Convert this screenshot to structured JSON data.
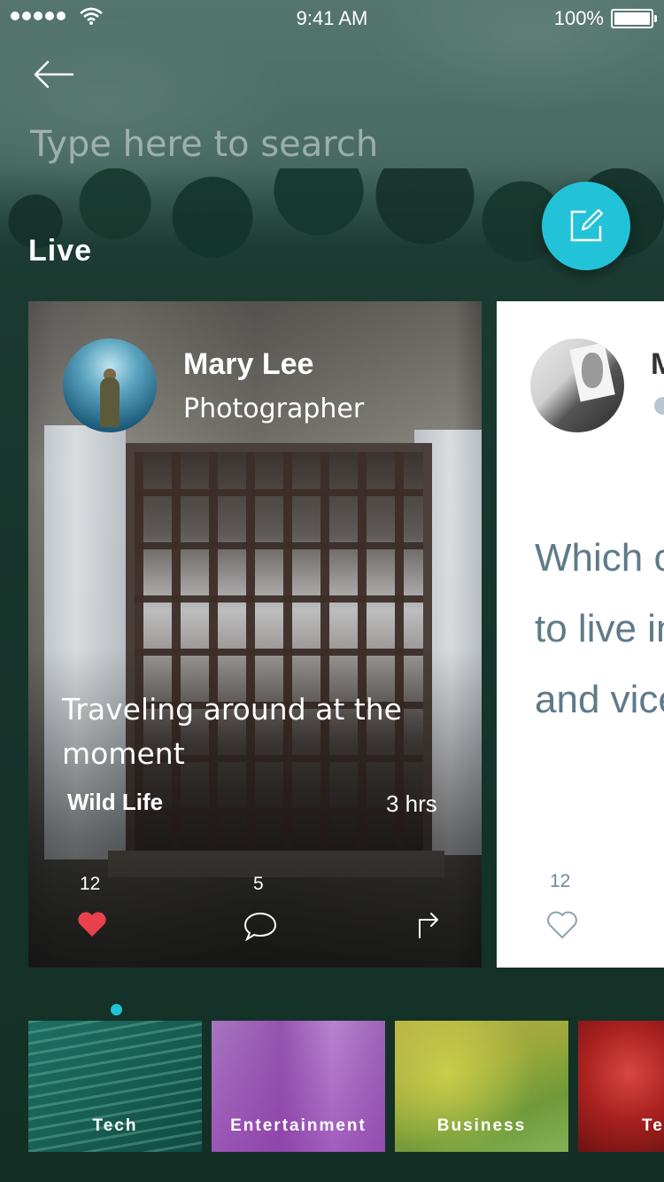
{
  "status": {
    "time": "9:41 AM",
    "battery": "100%"
  },
  "search": {
    "placeholder": "Type here to search"
  },
  "section": {
    "title": "Live"
  },
  "cards": [
    {
      "name": "Mary Lee",
      "role": "Photographer",
      "text": "Traveling around at the moment",
      "category": "Wild Life",
      "time": "3 hrs",
      "likes": "12",
      "comments": "5",
      "liked": true
    },
    {
      "name": "M",
      "text_lines": [
        "Which c",
        "to live in",
        "and vice"
      ],
      "likes": "12",
      "liked": false
    }
  ],
  "categories": [
    "Tech",
    "Entertainment",
    "Business",
    "Te"
  ],
  "colors": {
    "accent": "#22c3d8",
    "like": "#e8414b"
  },
  "icons": [
    "back-arrow-icon",
    "compose-icon",
    "heart-icon",
    "comment-icon",
    "share-icon",
    "location-icon"
  ]
}
